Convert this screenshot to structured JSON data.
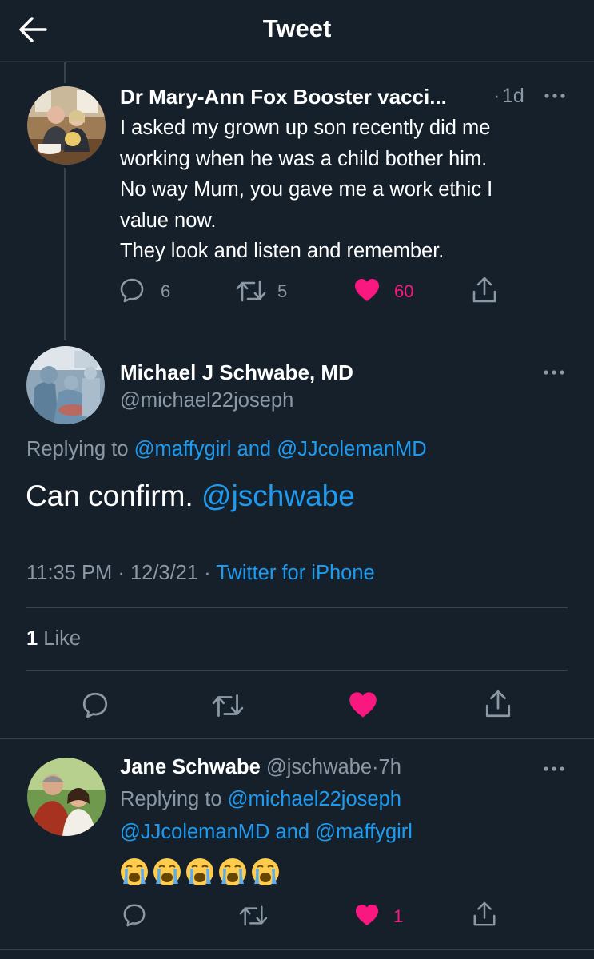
{
  "header": {
    "title": "Tweet"
  },
  "tweet1": {
    "display_name": "Dr Mary-Ann Fox Booster vacci...",
    "age": "1d",
    "sep": "·",
    "lines": [
      "I asked my grown up son recently did me",
      "working when he was a child bother him.",
      "No way Mum, you gave me a work ethic I",
      "value now.",
      "They look and listen and remember."
    ],
    "replies": "6",
    "retweets": "5",
    "likes": "60"
  },
  "main": {
    "display_name": "Michael J Schwabe, MD",
    "handle": "@michael22joseph",
    "replying_prefix": "Replying to",
    "replying_user1": "@maffygirl",
    "replying_and": "and",
    "replying_user2": "@JJcolemanMD",
    "text": "Can confirm.",
    "mention": "@jschwabe",
    "time": "11:35 PM",
    "date": "12/3/21",
    "sep": "·",
    "source": "Twitter for iPhone",
    "like_count": "1",
    "like_label": "Like"
  },
  "reply": {
    "display_name": "Jane Schwabe",
    "handle": "@jschwabe",
    "sep": "·",
    "age": "7h",
    "replying_prefix": "Replying to",
    "replying_user1": "@michael22joseph",
    "replying_user2": "@JJcolemanMD",
    "replying_and": "and",
    "replying_user3": "@maffygirl",
    "emojis": [
      "crying-face",
      "crying-face",
      "crying-face",
      "crying-face",
      "crying-face"
    ],
    "likes": "1"
  },
  "colors": {
    "background": "#15202b",
    "accent": "#1d9bf0",
    "like": "#f91880",
    "muted": "#8b98a5",
    "divider": "#38444d"
  }
}
